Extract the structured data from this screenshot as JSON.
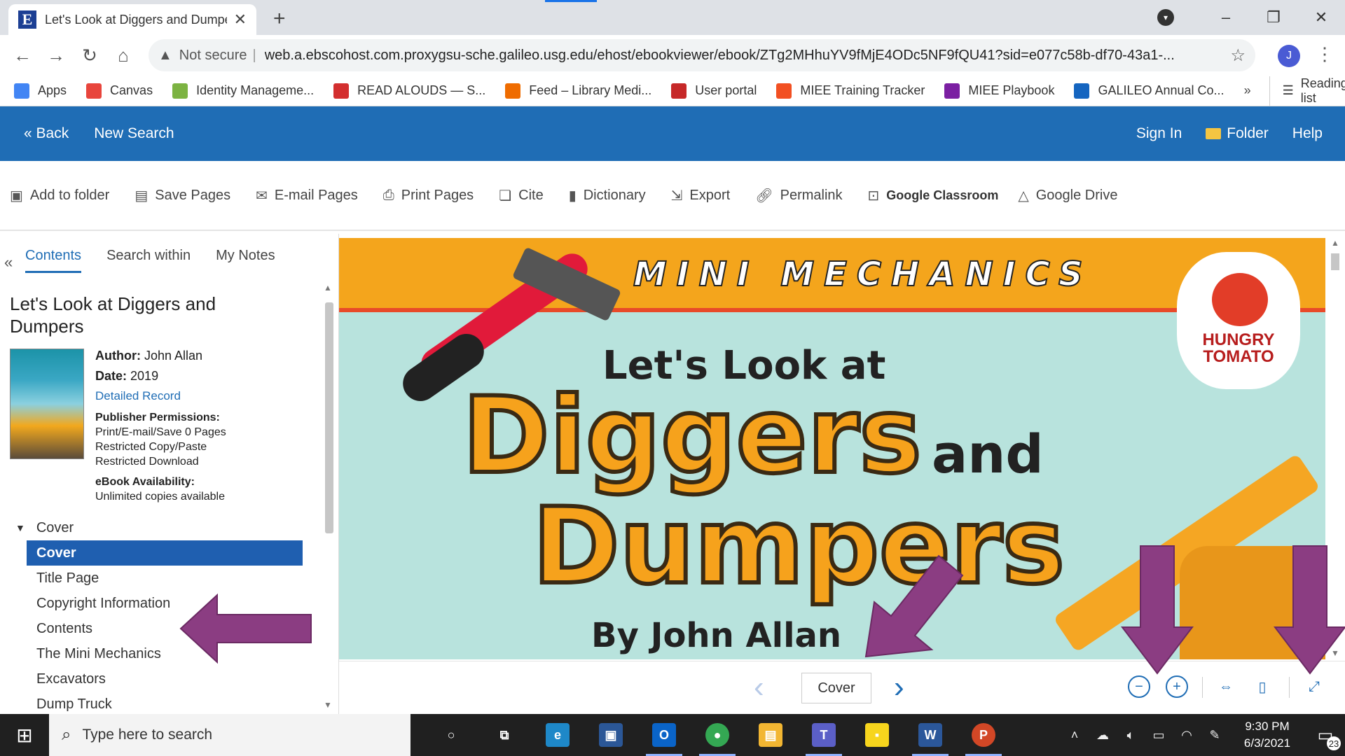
{
  "browser": {
    "tab_title": "Let's Look at Diggers and Dumpe",
    "tab_favicon": "E",
    "not_secure": "Not secure",
    "url": "web.a.ebscohost.com.proxygsu-sche.galileo.usg.edu/ehost/ebookviewer/ebook/ZTg2MHhuYV9fMjE4ODc5NF9fQU41?sid=e077c58b-df70-43a1-...",
    "profile_initial": "J",
    "bookmarks": [
      {
        "label": "Apps",
        "color": "#4285f4"
      },
      {
        "label": "Canvas",
        "color": "#e8453c"
      },
      {
        "label": "Identity Manageme...",
        "color": "#7cb342"
      },
      {
        "label": "READ ALOUDS — S...",
        "color": "#d32f2f"
      },
      {
        "label": "Feed – Library Medi...",
        "color": "#ef6c00"
      },
      {
        "label": "User portal",
        "color": "#c62828"
      },
      {
        "label": "MIEE Training Tracker",
        "color": "#f25022"
      },
      {
        "label": "MIEE Playbook",
        "color": "#7b1fa2"
      },
      {
        "label": "GALILEO Annual Co...",
        "color": "#1565c0"
      }
    ],
    "bookmarks_more": "»",
    "reading_list": "Reading list"
  },
  "ebsco": {
    "back": "« Back",
    "new_search": "New Search",
    "sign_in": "Sign In",
    "folder": "Folder",
    "help": "Help"
  },
  "actions": {
    "add_to_folder": "Add to folder",
    "save_pages": "Save Pages",
    "email_pages": "E-mail Pages",
    "print_pages": "Print Pages",
    "cite": "Cite",
    "dictionary": "Dictionary",
    "export": "Export",
    "permalink": "Permalink",
    "google_classroom": "Google Classroom",
    "google_drive": "Google Drive"
  },
  "panel": {
    "collapse": "«",
    "tabs": [
      "Contents",
      "Search within",
      "My Notes"
    ],
    "book_title": "Let's Look at Diggers and Dumpers",
    "author_label": "Author:",
    "author": "John Allan",
    "date_label": "Date:",
    "date": "2019",
    "detailed_record": "Detailed Record",
    "permissions_label": "Publisher Permissions:",
    "permissions": [
      "Print/E-mail/Save 0 Pages",
      "Restricted Copy/Paste",
      "Restricted Download"
    ],
    "availability_label": "eBook Availability:",
    "availability": "Unlimited copies available",
    "toc_section": "Cover",
    "toc_items": [
      "Cover",
      "Title Page",
      "Copyright Information",
      "Contents",
      "The Mini Mechanics",
      "Excavators",
      "Dump Truck"
    ]
  },
  "cover": {
    "series": "MINI MECHANICS",
    "publisher": [
      "HUNGRY",
      "TOMATO"
    ],
    "pretitle": "Let's Look at",
    "word1": "Diggers",
    "and": "and",
    "word2": "Dumpers",
    "byline": "By John Allan"
  },
  "viewer": {
    "current_page": "Cover",
    "prev_icon": "chevron-left",
    "next_icon": "chevron-right",
    "zoom_out_icon": "zoom-out",
    "zoom_in_icon": "zoom-in",
    "fit_width_icon": "fit-width",
    "fit_page_icon": "fit-page",
    "fullscreen_icon": "fullscreen"
  },
  "annotation_color": "#8b3d82",
  "taskbar": {
    "search_placeholder": "Type here to search",
    "time": "9:30 PM",
    "date": "6/3/2021",
    "notifications": "23",
    "apps": [
      {
        "name": "cortana",
        "glyph": "○",
        "color": "transparent"
      },
      {
        "name": "task-view",
        "glyph": "⧉",
        "color": "transparent"
      },
      {
        "name": "edge",
        "glyph": "e",
        "color": "#1e88c8"
      },
      {
        "name": "store",
        "glyph": "▣",
        "color": "#2b5797"
      },
      {
        "name": "outlook",
        "glyph": "O",
        "color": "#0a64c8"
      },
      {
        "name": "chrome",
        "glyph": "●",
        "color": "#34a853"
      },
      {
        "name": "file-explorer",
        "glyph": "▤",
        "color": "#f2b632"
      },
      {
        "name": "teams",
        "glyph": "T",
        "color": "#5b5fc7"
      },
      {
        "name": "sticky-notes",
        "glyph": "▪",
        "color": "#f7d51d"
      },
      {
        "name": "word",
        "glyph": "W",
        "color": "#2b579a"
      },
      {
        "name": "powerpoint",
        "glyph": "P",
        "color": "#d24726"
      }
    ]
  }
}
